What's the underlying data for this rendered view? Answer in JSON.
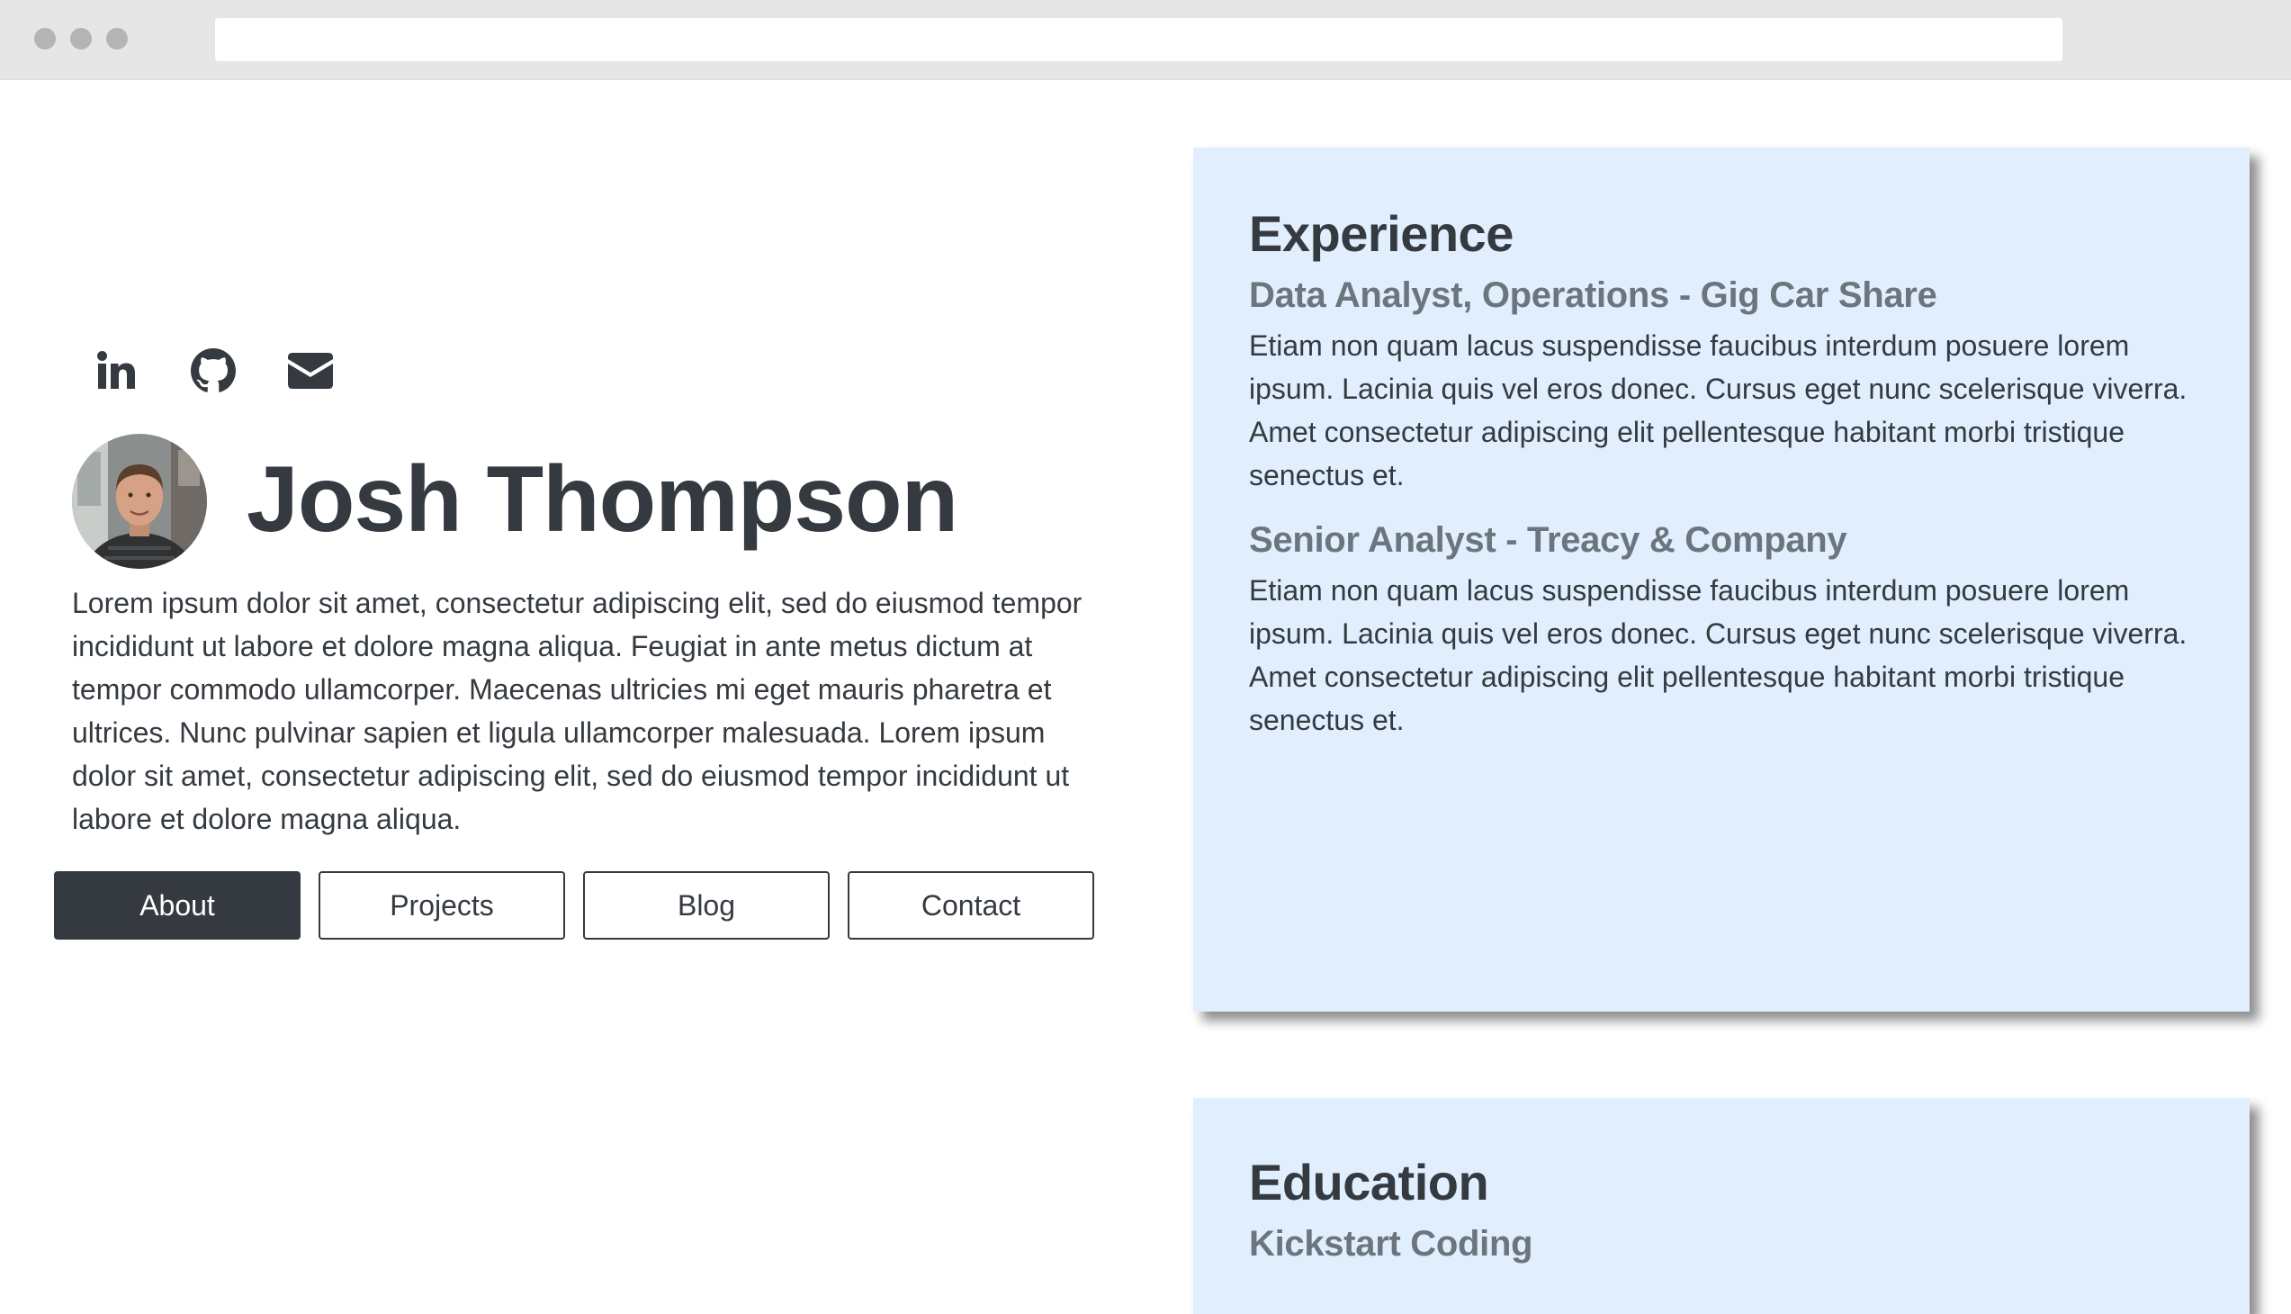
{
  "social": {
    "icons": [
      "linkedin-icon",
      "github-icon",
      "envelope-icon"
    ]
  },
  "profile": {
    "name": "Josh Thompson",
    "bio": "Lorem ipsum dolor sit amet, consectetur adipiscing elit, sed do eiusmod tempor incididunt ut labore et dolore magna aliqua. Feugiat in ante metus dictum at tempor commodo ullamcorper. Maecenas ultricies mi eget mauris pharetra et ultrices. Nunc pulvinar sapien et ligula ullamcorper malesuada. Lorem ipsum dolor sit amet, consectetur adipiscing elit, sed do eiusmod tempor incididunt ut labore et dolore magna aliqua."
  },
  "nav": {
    "about": "About",
    "projects": "Projects",
    "blog": "Blog",
    "contact": "Contact",
    "active": "About"
  },
  "experience": {
    "heading": "Experience",
    "jobs": [
      {
        "title": "Data Analyst, Operations - Gig Car Share",
        "description": "Etiam non quam lacus suspendisse faucibus interdum posuere lorem ipsum. Lacinia quis vel eros donec. Cursus eget nunc scelerisque viverra. Amet consectetur adipiscing elit pellentesque habitant morbi tristique senectus et."
      },
      {
        "title": "Senior Analyst - Treacy & Company",
        "description": "Etiam non quam lacus suspendisse faucibus interdum posuere lorem ipsum. Lacinia quis vel eros donec. Cursus eget nunc scelerisque viverra. Amet consectetur adipiscing elit pellentesque habitant morbi tristique senectus et."
      }
    ]
  },
  "education": {
    "heading": "Education",
    "schools": [
      {
        "name": "Kickstart Coding"
      }
    ]
  },
  "colors": {
    "dark": "#343a40",
    "muted": "#6c757d",
    "card_bg": "#e1eefd"
  }
}
